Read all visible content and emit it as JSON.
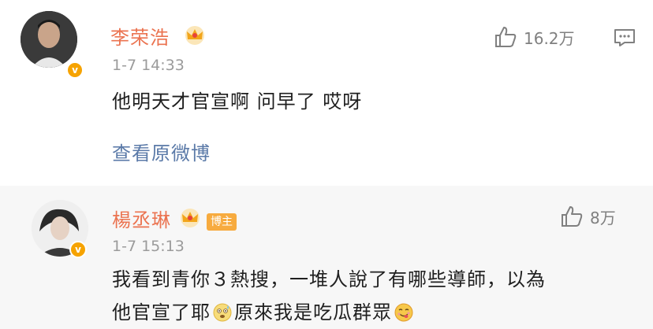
{
  "comments": [
    {
      "author": "李荣浩",
      "time": "1-7 14:33",
      "likes": "16.2万",
      "text": "他明天才官宣啊 问早了 哎呀",
      "link": "查看原微博",
      "avatar_badge": "v"
    },
    {
      "author": "楊丞琳",
      "tag": "博主",
      "time": "1-7 15:13",
      "likes": "8万",
      "text_line1": "我看到青你３熱搜，一堆人說了有哪些導師，以為",
      "text_line2a": "他官宣了耶",
      "text_line2b": "原來我是吃瓜群眾",
      "avatar_badge": "v"
    }
  ],
  "colors": {
    "name": "#eb7350",
    "link": "#5b7aa8",
    "badge": "#f6a300",
    "tag": "#f7ab3f"
  },
  "icons": [
    "crown-icon",
    "thumbs-up-icon",
    "comment-bubble-icon",
    "verified-badge-icon",
    "sweat-emoji-icon",
    "yum-emoji-icon"
  ]
}
